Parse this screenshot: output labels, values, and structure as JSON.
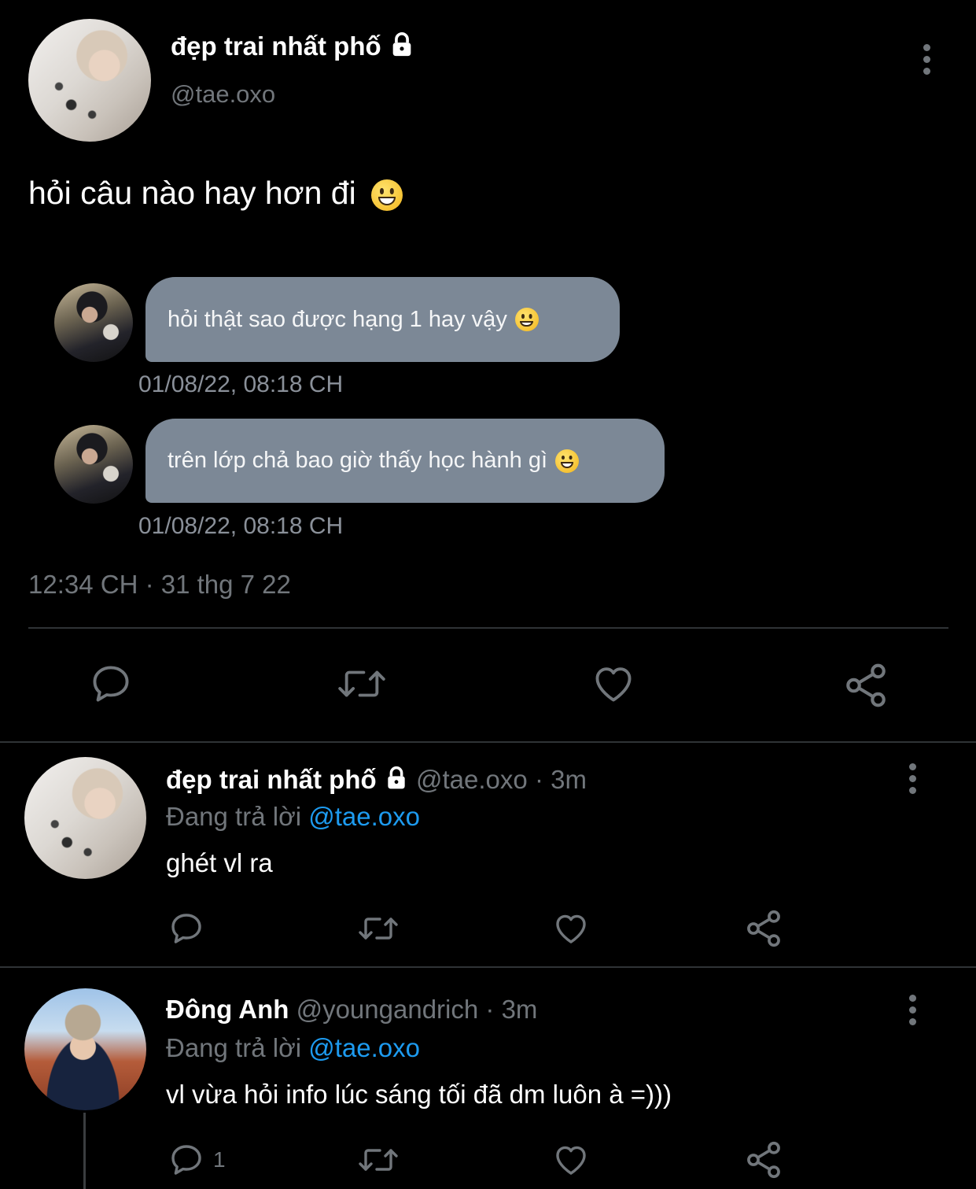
{
  "tweet": {
    "name": "đẹp trai nhất phố",
    "handle": "@tae.oxo",
    "text": "hỏi câu nào hay hơn đi",
    "messages": [
      {
        "text": "hỏi thật sao được hạng 1 hay vậy",
        "time": "01/08/22, 08:18 CH"
      },
      {
        "text": "trên lớp chả bao giờ thấy học hành gì",
        "time": "01/08/22, 08:18 CH"
      }
    ],
    "timestamp": "12:34 CH · 31 thg 7 22"
  },
  "replies": [
    {
      "name": "đẹp trai nhất phố",
      "handle": "@tae.oxo",
      "time": "· 3m",
      "replying_prefix": "Đang trả lời",
      "replying_to": "@tae.oxo",
      "text": "ghét vl ra",
      "reply_count": ""
    },
    {
      "name": "Đông Anh",
      "handle": "@youngandrich",
      "time": "· 3m",
      "replying_prefix": "Đang trả lời",
      "replying_to": "@tae.oxo",
      "text": "vl vừa hỏi info lúc sáng tối đã dm luôn à =)))",
      "reply_count": "1"
    }
  ],
  "icons": {
    "lock": "lock-icon",
    "more": "more-vertical-icon",
    "reply": "comment-icon",
    "retweet": "retweet-icon",
    "like": "heart-icon",
    "share": "share-icon",
    "emoji": "grinning-face-emoji"
  },
  "colors": {
    "background": "#000000",
    "text": "#e7e9ea",
    "muted": "#71767b",
    "link": "#1d9bf0",
    "bubble": "#7c8896"
  }
}
